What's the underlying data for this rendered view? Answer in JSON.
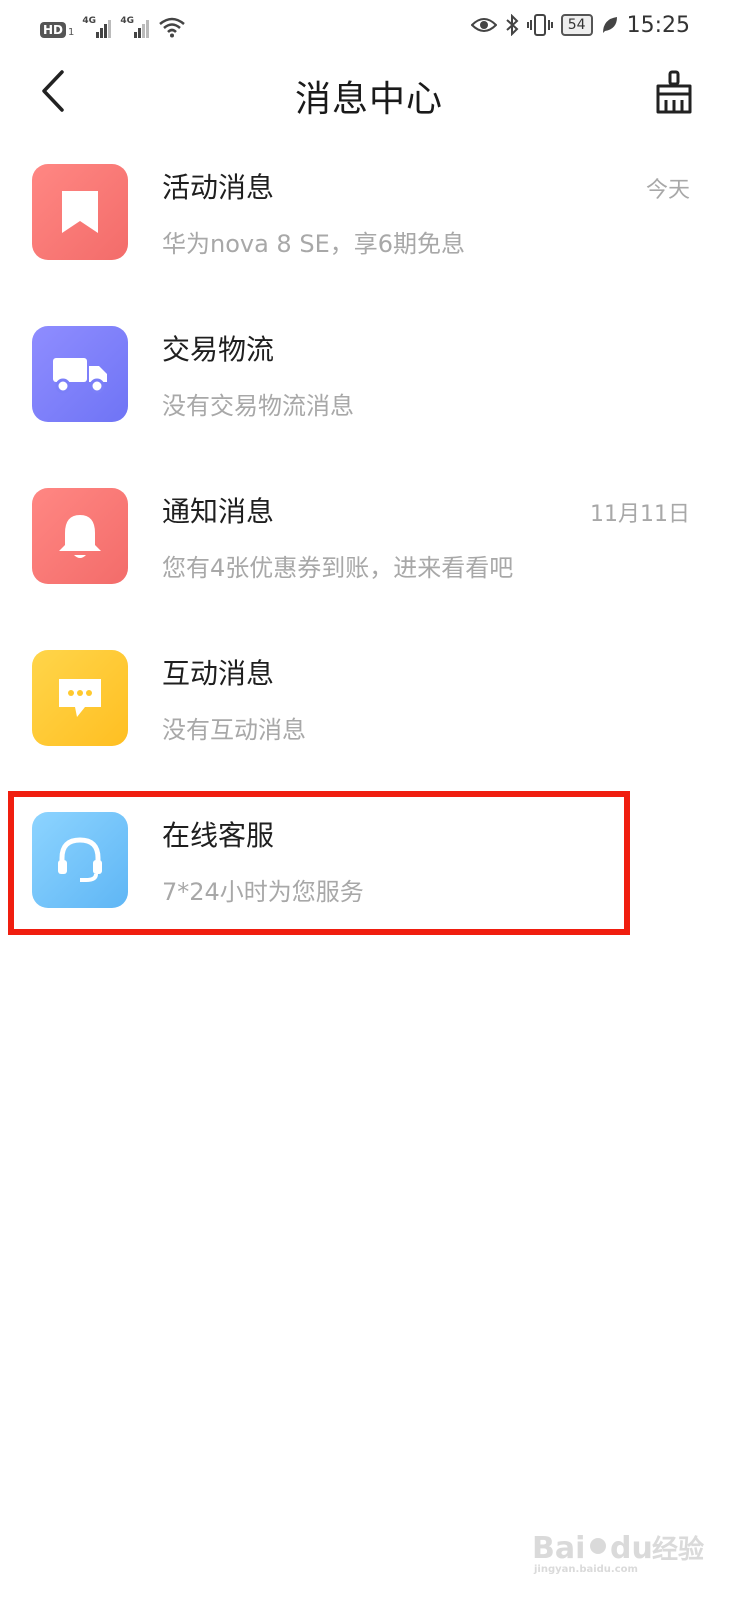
{
  "status_bar": {
    "hd_label": "HD",
    "sim1_number": "1",
    "network1_label": "4G",
    "network2_label": "4G",
    "battery_level": "54",
    "time": "15:25",
    "icons": [
      "wifi-icon",
      "eye-icon",
      "bluetooth-icon",
      "vibrate-icon",
      "leaf-icon"
    ]
  },
  "nav": {
    "title": "消息中心",
    "back_icon": "chevron-left-icon",
    "clean_icon": "broom-icon"
  },
  "messages": [
    {
      "title": "活动消息",
      "subtitle": "华为nova 8 SE，享6期免息",
      "date": "今天",
      "icon": "bookmark-icon",
      "color": "#f77672"
    },
    {
      "title": "交易物流",
      "subtitle": "没有交易物流消息",
      "date": "",
      "icon": "truck-icon",
      "color": "#7b7ff8"
    },
    {
      "title": "通知消息",
      "subtitle": "您有4张优惠券到账，进来看看吧",
      "date": "11月11日",
      "icon": "bell-icon",
      "color": "#f77672"
    },
    {
      "title": "互动消息",
      "subtitle": "没有互动消息",
      "date": "",
      "icon": "chat-bubble-icon",
      "color": "#ffc92e"
    },
    {
      "title": "在线客服",
      "subtitle": "7*24小时为您服务",
      "date": "",
      "icon": "headset-icon",
      "color": "#6fc0f7"
    }
  ],
  "highlight_color": "#f01e0f",
  "watermark": {
    "brand": "Baidu经验",
    "url": "jingyan.baidu.com"
  }
}
